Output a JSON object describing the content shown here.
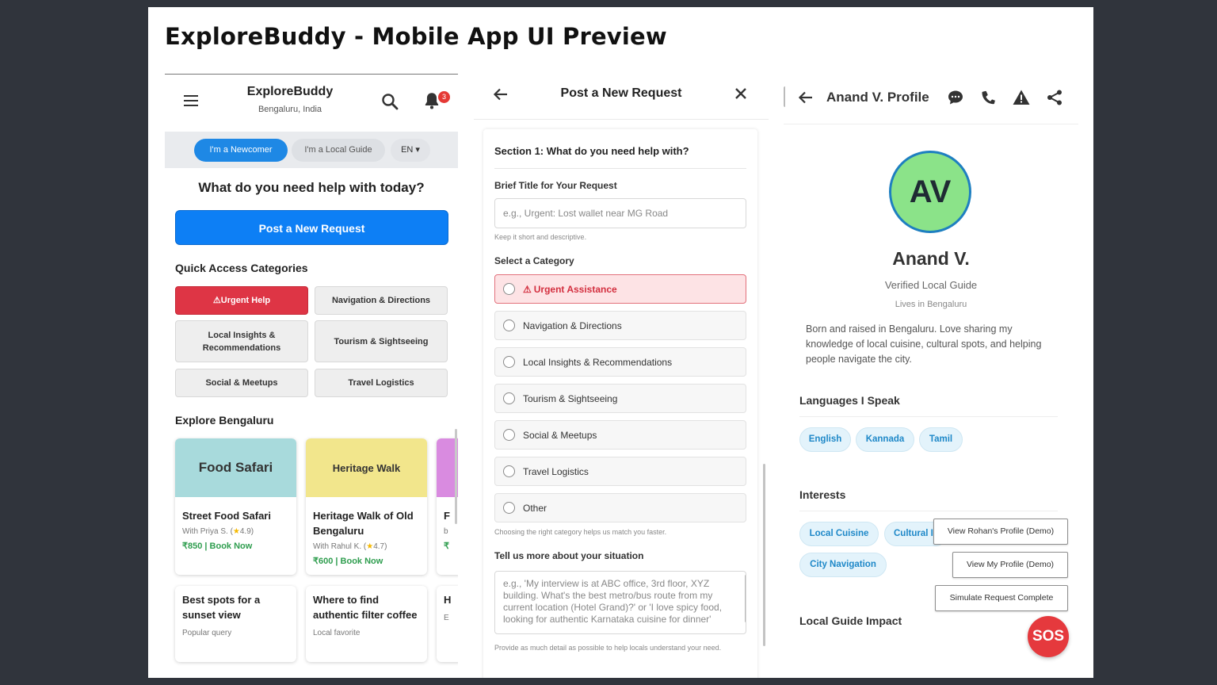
{
  "page": {
    "title": "ExploreBuddy - Mobile App UI Preview"
  },
  "home": {
    "app_name": "ExploreBuddy",
    "city": "Bengaluru, India",
    "notification_count": "3",
    "role_newcomer": "I'm a Newcomer",
    "role_guide": "I'm a Local Guide",
    "language": "EN",
    "question": "What do you need help with today?",
    "post_button": "Post a New Request",
    "quick_title": "Quick Access Categories",
    "categories": [
      "Urgent Help",
      "Navigation & Directions",
      "Local Insights & Recommendations",
      "Tourism & Sightseeing",
      "Social & Meetups",
      "Travel Logistics"
    ],
    "explore_title": "Explore Bengaluru",
    "experiences": [
      {
        "image_label": "Food Safari",
        "image_color": "#a8dadc",
        "title": "Street Food Safari",
        "host": "With Priya S. (",
        "rating": "4.9",
        "price": "₹850 | Book Now"
      },
      {
        "image_label": "Heritage Walk",
        "image_color": "#f2e68c",
        "title": "Heritage Walk of Old Bengaluru",
        "host": "With Rahul K. (",
        "rating": "4.7",
        "price": "₹600 | Book Now"
      },
      {
        "image_label": "",
        "image_color": "#d98be0",
        "title": "F",
        "host": "b",
        "rating": "",
        "price": "₹"
      }
    ],
    "queries": [
      {
        "title": "Best spots for a sunset view",
        "tag": "Popular query"
      },
      {
        "title": "Where to find authentic filter coffee",
        "tag": "Local favorite"
      },
      {
        "title": "H",
        "tag": "E"
      }
    ]
  },
  "request": {
    "title": "Post a New Request",
    "section_title": "Section 1: What do you need help with?",
    "title_label": "Brief Title for Your Request",
    "title_placeholder": "e.g., Urgent: Lost wallet near MG Road",
    "title_help": "Keep it short and descriptive.",
    "category_label": "Select a Category",
    "options": [
      "Urgent Assistance",
      "Navigation & Directions",
      "Local Insights & Recommendations",
      "Tourism & Sightseeing",
      "Social & Meetups",
      "Travel Logistics",
      "Other"
    ],
    "category_help": "Choosing the right category helps us match you faster.",
    "details_label": "Tell us more about your situation",
    "details_placeholder": "e.g., 'My interview is at ABC office, 3rd floor, XYZ building. What's the best metro/bus route from my current location (Hotel Grand)?' or 'I love spicy food, looking for authentic Karnataka cuisine for dinner'",
    "details_help": "Provide as much detail as possible to help locals understand your need."
  },
  "profile": {
    "header_title": "Anand V. Profile",
    "initials": "AV",
    "name": "Anand V.",
    "role": "Verified Local Guide",
    "location": "Lives in Bengaluru",
    "bio": "Born and raised in Bengaluru. Love sharing my knowledge of local cuisine, cultural spots, and helping people navigate the city.",
    "languages_title": "Languages I Speak",
    "languages": [
      "English",
      "Kannada",
      "Tamil"
    ],
    "interests_title": "Interests",
    "interests": [
      "Local Cuisine",
      "Cultural I",
      "City Navigation"
    ],
    "impact_title": "Local Guide Impact",
    "demo_rohan": "View Rohan's Profile (Demo)",
    "demo_my": "View My Profile (Demo)",
    "demo_simulate": "Simulate Request Complete",
    "sos": "SOS"
  },
  "colors": {
    "primary": "#0d7ff5",
    "urgent": "#de3545",
    "success": "#2e9d4e",
    "chip_text": "#1e88c8",
    "avatar_bg": "#8be389"
  }
}
